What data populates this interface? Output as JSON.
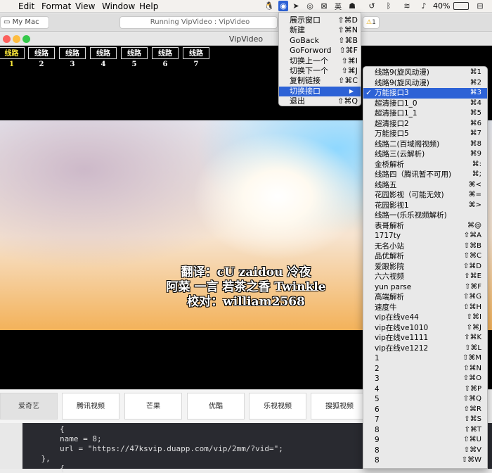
{
  "menubar": {
    "items": [
      "Edit",
      "Format",
      "View",
      "Window",
      "Help"
    ],
    "battery": "40%"
  },
  "xcode_toolbar": {
    "scheme": "My Mac",
    "status": "Running VipVideo : VipVideo",
    "warning_count": "1"
  },
  "window": {
    "title": "VipVideo"
  },
  "routes": [
    "线路1",
    "线路2",
    "线路3",
    "线路4",
    "线路5",
    "线路6",
    "线路7"
  ],
  "subtitles": [
    "翻译：cU zaidou 冷夜",
    "阿菜 一言 若茶之香 Twinkle",
    "校对：william2568"
  ],
  "sites": [
    "爱奇艺",
    "腾讯视频",
    "芒果",
    "优酷",
    "乐视视频",
    "搜狐视频"
  ],
  "code_lines": [
    "        {",
    "        name = 8;",
    "        url = \"https://47ksvip.duapp.com/vip/2mm/?vid=\";",
    "    },",
    "        {"
  ],
  "app_menu": [
    {
      "label": "展示窗口",
      "shortcut": "⇧⌘D"
    },
    {
      "label": "新建",
      "shortcut": "⇧⌘N"
    },
    {
      "label": "GoBack",
      "shortcut": "⇧⌘B"
    },
    {
      "label": "GoForword",
      "shortcut": "⇧⌘F"
    },
    {
      "label": "切换上一个",
      "shortcut": "⇧⌘I"
    },
    {
      "label": "切换下一个",
      "shortcut": "⇧⌘J"
    },
    {
      "label": "复制链接",
      "shortcut": "⇧⌘C"
    },
    {
      "label": "切换接口",
      "shortcut": "▶"
    },
    {
      "label": "退出",
      "shortcut": "⇧⌘Q"
    }
  ],
  "submenu": [
    {
      "label": "线路9(旋风动漫)",
      "shortcut": "⌘1"
    },
    {
      "label": "线路9(旋风动漫)",
      "shortcut": "⌘2"
    },
    {
      "label": "万能接口3",
      "shortcut": "⌘3"
    },
    {
      "label": "超清接口1_0",
      "shortcut": "⌘4"
    },
    {
      "label": "超清接口1_1",
      "shortcut": "⌘5"
    },
    {
      "label": "超清接口2",
      "shortcut": "⌘6"
    },
    {
      "label": "万能接口5",
      "shortcut": "⌘7"
    },
    {
      "label": "线路二(百域阁视频)",
      "shortcut": "⌘8"
    },
    {
      "label": "线路三(云解析)",
      "shortcut": "⌘9"
    },
    {
      "label": "金桥解析",
      "shortcut": "⌘:"
    },
    {
      "label": "线路四（腾讯暂不可用)",
      "shortcut": "⌘;"
    },
    {
      "label": "线路五",
      "shortcut": "⌘<"
    },
    {
      "label": "花园影视（可能无效)",
      "shortcut": "⌘="
    },
    {
      "label": "花园影视1",
      "shortcut": "⌘>"
    },
    {
      "label": "线路一(乐乐视频解析)",
      "shortcut": ""
    },
    {
      "label": "表哥解析",
      "shortcut": "⌘@"
    },
    {
      "label": "1717ty",
      "shortcut": "⇧⌘A"
    },
    {
      "label": "无名小站",
      "shortcut": "⇧⌘B"
    },
    {
      "label": "品优解析",
      "shortcut": "⇧⌘C"
    },
    {
      "label": "爱跟影院",
      "shortcut": "⇧⌘D"
    },
    {
      "label": "六六视频",
      "shortcut": "⇧⌘E"
    },
    {
      "label": "yun parse",
      "shortcut": "⇧⌘F"
    },
    {
      "label": "高端解析",
      "shortcut": "⇧⌘G"
    },
    {
      "label": "速度牛",
      "shortcut": "⇧⌘H"
    },
    {
      "label": "vip在线ve44",
      "shortcut": "⇧⌘I"
    },
    {
      "label": "vip在线ve1010",
      "shortcut": "⇧⌘J"
    },
    {
      "label": "vip在线ve1111",
      "shortcut": "⇧⌘K"
    },
    {
      "label": "vip在线ve1212",
      "shortcut": "⇧⌘L"
    },
    {
      "label": "1",
      "shortcut": "⇧⌘M"
    },
    {
      "label": "2",
      "shortcut": "⇧⌘N"
    },
    {
      "label": "3",
      "shortcut": "⇧⌘O"
    },
    {
      "label": "4",
      "shortcut": "⇧⌘P"
    },
    {
      "label": "5",
      "shortcut": "⇧⌘Q"
    },
    {
      "label": "6",
      "shortcut": "⇧⌘R"
    },
    {
      "label": "7",
      "shortcut": "⇧⌘S"
    },
    {
      "label": "8",
      "shortcut": "⇧⌘T"
    },
    {
      "label": "9",
      "shortcut": "⇧⌘U"
    },
    {
      "label": "8",
      "shortcut": "⇧⌘V"
    },
    {
      "label": "8",
      "shortcut": "⇧⌘W"
    }
  ],
  "colors": {
    "menu_highlight": "#2d62d6",
    "active_route": "#ffeb3b"
  }
}
